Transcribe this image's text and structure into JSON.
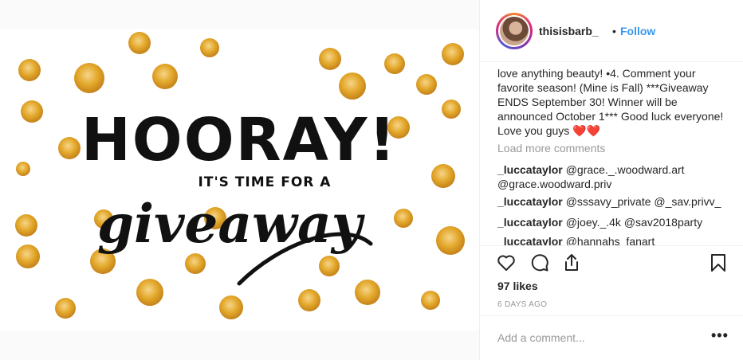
{
  "post": {
    "image": {
      "headline": "HOORAY!",
      "subline": "IT'S TIME FOR A",
      "script_word": "giveaway",
      "accent_color": "#e3a82b"
    },
    "header": {
      "username": "thisisbarb_",
      "separator": "•",
      "follow_label": "Follow"
    },
    "caption": "love anything beauty! •4. Comment your favorite season! (Mine is Fall) ***Giveaway ENDS September 30! Winner will be announced October 1*** Good luck everyone! Love you guys ❤️❤️",
    "load_more": "Load more comments",
    "comments": [
      {
        "user": "_luccataylor",
        "text": "@grace._.woodward.art @grace.woodward.priv"
      },
      {
        "user": "_luccataylor",
        "text": "@sssavy_private @_sav.privv_"
      },
      {
        "user": "_luccataylor",
        "text": "@joey._.4k @sav2018party"
      },
      {
        "user": "_luccataylor",
        "text": "@hannahs_fanart"
      }
    ],
    "actions": {
      "like_icon": "heart-icon",
      "comment_icon": "comment-icon",
      "share_icon": "share-icon",
      "save_icon": "bookmark-icon"
    },
    "likes": "97 likes",
    "timestamp": "6 DAYS AGO",
    "add_comment_placeholder": "Add a comment...",
    "more_options": "•••"
  },
  "colors": {
    "follow": "#3897f0",
    "muted": "#999999",
    "text": "#262626"
  }
}
